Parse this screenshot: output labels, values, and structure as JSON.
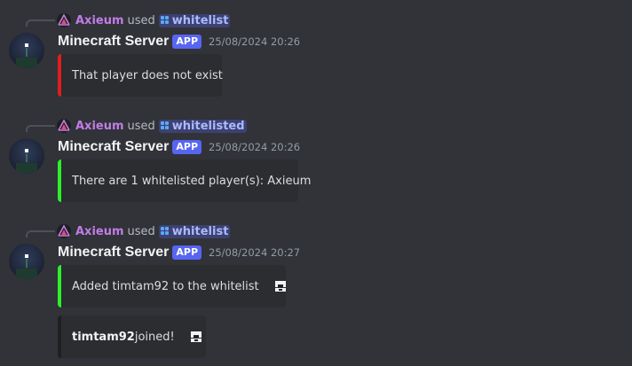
{
  "colors": {
    "background": "#313338",
    "embed_bg": "#2b2d31",
    "error": "#e01e1e",
    "success": "#2bf02b",
    "neutral": "#1e1f22",
    "app_badge": "#5865f2",
    "reply_user": "#c27ce8"
  },
  "messages": [
    {
      "reply": {
        "user": "Axieum",
        "used": "used",
        "command": "whitelist"
      },
      "author": "Minecraft Server",
      "badge": "APP",
      "timestamp": "25/08/2024 20:26",
      "embeds": [
        {
          "text": "That player does not exist",
          "status": "error"
        }
      ]
    },
    {
      "reply": {
        "user": "Axieum",
        "used": "used",
        "command": "whitelisted"
      },
      "author": "Minecraft Server",
      "badge": "APP",
      "timestamp": "25/08/2024 20:26",
      "embeds": [
        {
          "text": "There are 1 whitelisted player(s): Axieum",
          "status": "success"
        }
      ]
    },
    {
      "reply": {
        "user": "Axieum",
        "used": "used",
        "command": "whitelist"
      },
      "author": "Minecraft Server",
      "badge": "APP",
      "timestamp": "25/08/2024 20:27",
      "embeds": [
        {
          "text": "Added timtam92 to the whitelist",
          "status": "success",
          "icon": "player-head-icon"
        },
        {
          "bold": "timtam92",
          "text": " joined!",
          "status": "neutral",
          "icon": "player-head-icon"
        }
      ]
    }
  ]
}
